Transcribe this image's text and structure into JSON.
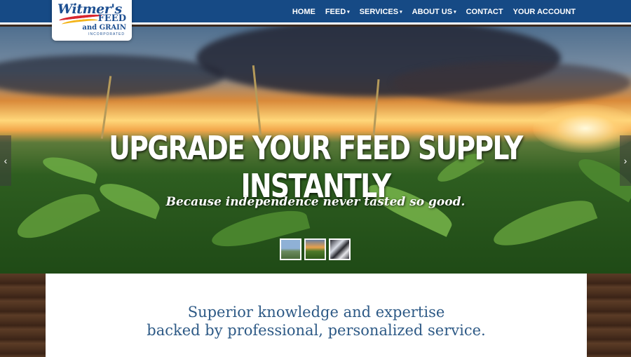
{
  "brand": {
    "logo_script": "Witmer's",
    "logo_line1": "FEED",
    "logo_line2": "and GRAIN",
    "logo_line3": "INCORPORATED",
    "colors": {
      "header": "#164a85",
      "tagline": "#2e5a86"
    }
  },
  "nav": {
    "items": [
      {
        "label": "HOME",
        "active": true,
        "dropdown": false
      },
      {
        "label": "FEED",
        "active": false,
        "dropdown": true
      },
      {
        "label": "SERVICES",
        "active": false,
        "dropdown": true
      },
      {
        "label": "ABOUT US",
        "active": false,
        "dropdown": true
      },
      {
        "label": "CONTACT",
        "active": false,
        "dropdown": false
      },
      {
        "label": "YOUR ACCOUNT",
        "active": false,
        "dropdown": false
      }
    ],
    "caret_icon": "▾"
  },
  "hero": {
    "title": "UPGRADE YOUR FEED SUPPLY INSTANTLY",
    "subtitle": "Because independence never tasted so good.",
    "prev_icon": "‹",
    "next_icon": "›",
    "thumbnails": [
      "slide-thumb-1",
      "slide-thumb-2",
      "slide-thumb-3"
    ]
  },
  "main": {
    "tagline_line1": "Superior knowledge and expertise",
    "tagline_line2": "backed by professional, personalized service."
  }
}
